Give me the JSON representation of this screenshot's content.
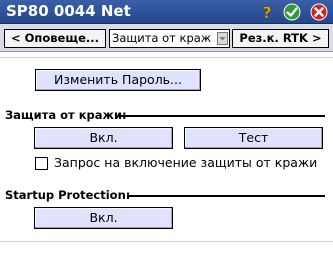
{
  "window": {
    "title": "SP80 0044 Net",
    "icons": [
      "question-mark-icon",
      "ok-checkmark-icon",
      "close-x-icon"
    ]
  },
  "navigation": {
    "prev_label": "< Оповеще...",
    "page_select_value": "Защита от краж",
    "next_label": "Рез.к. RTK >"
  },
  "content": {
    "change_password_label": "Изменить Пароль...",
    "theft_section": {
      "heading": "Защита от кражи:",
      "on_label": "Вкл.",
      "test_label": "Тест",
      "request_checkbox_label": "Запрос на включение защиты от кражи",
      "request_checked": false
    },
    "startup_section": {
      "heading": "Startup Protection:",
      "on_label": "Вкл."
    }
  },
  "colors": {
    "titlebar": "#2f519a",
    "button_face": "#dfe3ff",
    "ok_icon": "#2e9b3a",
    "close_icon": "#d42020",
    "help_icon": "#e6b000"
  }
}
